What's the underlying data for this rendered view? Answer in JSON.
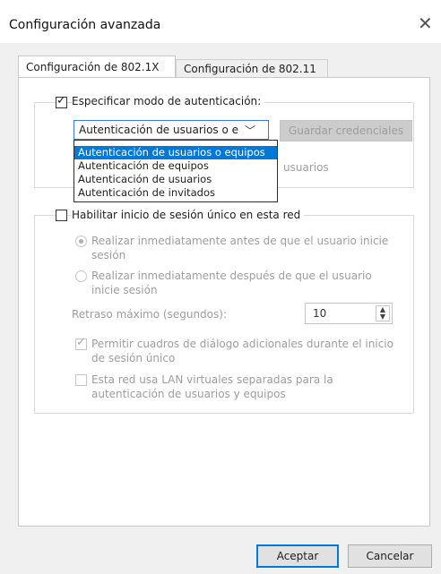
{
  "window": {
    "title": "Configuración avanzada"
  },
  "tabs": [
    {
      "label": "Configuración de 802.1X",
      "active": true
    },
    {
      "label": "Configuración de 802.11",
      "active": false
    }
  ],
  "auth": {
    "specify_label": "Especificar modo de autenticación:",
    "specify_checked": true,
    "selected_mode": "Autenticación de usuarios o e",
    "save_credentials_label": "Guardar credenciales",
    "hidden_text_fragment": "usuarios",
    "options": [
      "Autenticación de usuarios o equipos",
      "Autenticación de equipos",
      "Autenticación de usuarios",
      "Autenticación de invitados"
    ]
  },
  "sso": {
    "enable_label": "Habilitar inicio de sesión único en esta red",
    "enable_checked": false,
    "radio_before_label": "Realizar inmediatamente antes de que el usuario inicie sesión",
    "radio_after_label": "Realizar inmediatamente después de que el usuario inicie sesión",
    "max_delay_label": "Retraso máximo (segundos):",
    "max_delay_value": "10",
    "allow_dialogs_label": "Permitir cuadros de diálogo adicionales durante el inicio de sesión único",
    "allow_dialogs_checked": true,
    "vlan_label": "Esta red usa LAN virtuales separadas para la autenticación de usuarios y equipos",
    "vlan_checked": false
  },
  "footer": {
    "ok_label": "Aceptar",
    "cancel_label": "Cancelar"
  },
  "colors": {
    "accent": "#0078d7",
    "disabled_text": "#9d9d9d"
  },
  "icons": {
    "close": "close-icon",
    "chevron": "chevron-down-icon",
    "spinner": "spinner-arrows-icon"
  }
}
